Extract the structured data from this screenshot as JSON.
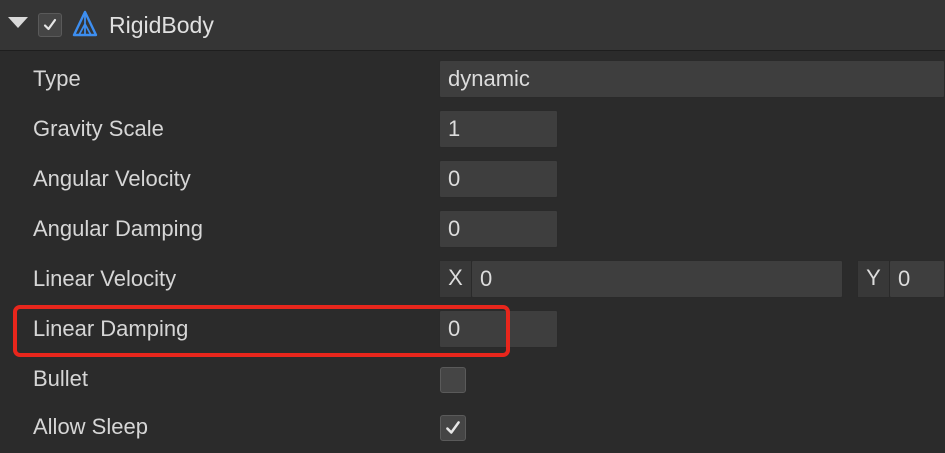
{
  "component": {
    "title": "RigidBody",
    "enabled": true
  },
  "properties": {
    "type": {
      "label": "Type",
      "value": "dynamic"
    },
    "gravity_scale": {
      "label": "Gravity Scale",
      "value": "1"
    },
    "angular_velocity": {
      "label": "Angular Velocity",
      "value": "0"
    },
    "angular_damping": {
      "label": "Angular Damping",
      "value": "0"
    },
    "linear_velocity": {
      "label": "Linear Velocity",
      "x_label": "X",
      "x_value": "0",
      "y_label": "Y",
      "y_value": "0"
    },
    "linear_damping": {
      "label": "Linear Damping",
      "value": "0"
    },
    "bullet": {
      "label": "Bullet",
      "checked": false
    },
    "allow_sleep": {
      "label": "Allow Sleep",
      "checked": true
    }
  },
  "colors": {
    "highlight": "#e8261c",
    "icon_accent": "#3d8ef0"
  },
  "icons": [
    "chevron-down-icon",
    "checkmark-icon",
    "rigidbody-icon"
  ]
}
